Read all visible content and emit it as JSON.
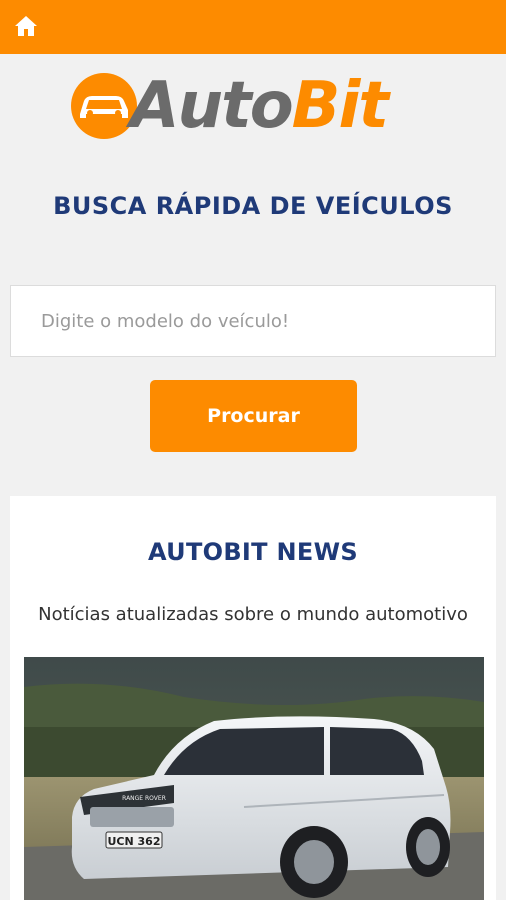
{
  "header": {
    "home_icon": "home-icon"
  },
  "logo": {
    "part1": "Auto",
    "part2": "Bit"
  },
  "search": {
    "title": "BUSCA RÁPIDA DE VEÍCULOS",
    "placeholder": "Digite o modelo do veículo!",
    "value": "",
    "button_label": "Procurar"
  },
  "news": {
    "title": "AUTOBIT NEWS",
    "subtitle": "Notícias atualizadas sobre o mundo automotivo",
    "image": {
      "plate": "UCN 362",
      "brand": "RANGE ROVER"
    }
  },
  "colors": {
    "accent": "#fd8b00",
    "heading": "#1f3a78",
    "logo_gray": "#6b6b6b"
  }
}
